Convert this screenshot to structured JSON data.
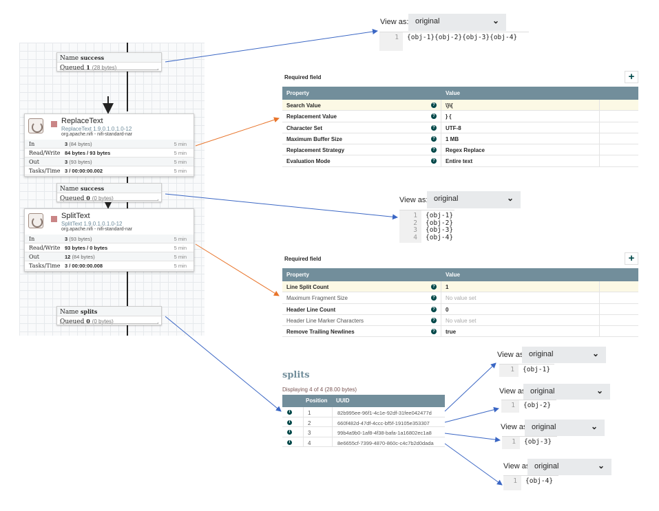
{
  "flow": {
    "connections": [
      {
        "name_label": "Name",
        "name": "success",
        "queued_label": "Queued",
        "queued_count": "1",
        "queued_size": "(28 bytes)"
      },
      {
        "name_label": "Name",
        "name": "success",
        "queued_label": "Queued",
        "queued_count": "0",
        "queued_size": "(0 bytes)"
      },
      {
        "name_label": "Name",
        "name": "splits",
        "queued_label": "Queued",
        "queued_count": "0",
        "queued_size": "(0 bytes)"
      }
    ],
    "processors": [
      {
        "name": "ReplaceText",
        "type": "ReplaceText 1.9.0.1.0.1.0-12",
        "bundle": "org.apache.nifi - nifi-standard-nar",
        "stats": [
          {
            "label": "In",
            "value": "3",
            "extra": "(84 bytes)",
            "time": "5 min"
          },
          {
            "label": "Read/Write",
            "value": "84 bytes / 93 bytes",
            "extra": "",
            "time": "5 min"
          },
          {
            "label": "Out",
            "value": "3",
            "extra": "(93 bytes)",
            "time": "5 min"
          },
          {
            "label": "Tasks/Time",
            "value": "3 / 00:00:00.002",
            "extra": "",
            "time": "5 min"
          }
        ]
      },
      {
        "name": "SplitText",
        "type": "SplitText 1.9.0.1.0.1.0-12",
        "bundle": "org.apache.nifi - nifi-standard-nar",
        "stats": [
          {
            "label": "In",
            "value": "3",
            "extra": "(93 bytes)",
            "time": "5 min"
          },
          {
            "label": "Read/Write",
            "value": "93 bytes / 0 bytes",
            "extra": "",
            "time": "5 min"
          },
          {
            "label": "Out",
            "value": "12",
            "extra": "(84 bytes)",
            "time": "5 min"
          },
          {
            "label": "Tasks/Time",
            "value": "3 / 00:00:00.008",
            "extra": "",
            "time": "5 min"
          }
        ]
      }
    ]
  },
  "viewers": [
    {
      "label": "View as:",
      "selected": "original",
      "lines": [
        "1"
      ],
      "content": [
        "{obj-1}{obj-2}{obj-3}{obj-4}"
      ]
    },
    {
      "label": "View as:",
      "selected": "original",
      "lines": [
        "1",
        "2",
        "3",
        "4"
      ],
      "content": [
        "{obj-1}",
        "{obj-2}",
        "{obj-3}",
        "{obj-4}"
      ]
    },
    {
      "label": "View as:",
      "selected": "original",
      "lines": [
        "1"
      ],
      "content": [
        "{obj-1}"
      ]
    },
    {
      "label": "View as:",
      "selected": "original",
      "lines": [
        "1"
      ],
      "content": [
        "{obj-2}"
      ]
    },
    {
      "label": "View as:",
      "selected": "original",
      "lines": [
        "1"
      ],
      "content": [
        "{obj-3}"
      ]
    },
    {
      "label": "View as:",
      "selected": "original",
      "lines": [
        "1"
      ],
      "content": [
        "{obj-4}"
      ]
    }
  ],
  "property_tables": [
    {
      "required_label": "Required field",
      "add": "+",
      "headers": [
        "Property",
        "Value"
      ],
      "rows": [
        {
          "name": "Search Value",
          "value": "\\}\\{",
          "required": true
        },
        {
          "name": "Replacement Value",
          "value": "} {",
          "required": true
        },
        {
          "name": "Character Set",
          "value": "UTF-8",
          "required": true
        },
        {
          "name": "Maximum Buffer Size",
          "value": "1 MB",
          "required": true
        },
        {
          "name": "Replacement Strategy",
          "value": "Regex Replace",
          "required": true
        },
        {
          "name": "Evaluation Mode",
          "value": "Entire text",
          "required": true
        }
      ]
    },
    {
      "required_label": "Required field",
      "add": "+",
      "headers": [
        "Property",
        "Value"
      ],
      "rows": [
        {
          "name": "Line Split Count",
          "value": "1",
          "required": true
        },
        {
          "name": "Maximum Fragment Size",
          "value": "No value set",
          "required": false
        },
        {
          "name": "Header Line Count",
          "value": "0",
          "required": true
        },
        {
          "name": "Header Line Marker Characters",
          "value": "No value set",
          "required": false
        },
        {
          "name": "Remove Trailing Newlines",
          "value": "true",
          "required": true
        }
      ]
    }
  ],
  "queue": {
    "title": "splits",
    "summary": "Displaying 4 of 4 (28.00 bytes)",
    "headers": [
      "Position",
      "UUID"
    ],
    "rows": [
      {
        "position": "1",
        "uuid": "82b995ee-96f1-4c1e-92df-31fee042477d"
      },
      {
        "position": "2",
        "uuid": "660f482d-47df-4ccc-bf5f-19105e353307"
      },
      {
        "position": "3",
        "uuid": "99b4a9b0-1af8-4f38-bafa-1a16802ec1a8"
      },
      {
        "position": "4",
        "uuid": "8e6655cf-7399-4870-860c-c4c7b2d0dada"
      }
    ]
  },
  "colors": {
    "header": "#728e9b",
    "accent": "#004849",
    "arrow_blue": "#3a66c4",
    "arrow_orange": "#e8742a",
    "highlight": "#fcf9e5"
  }
}
